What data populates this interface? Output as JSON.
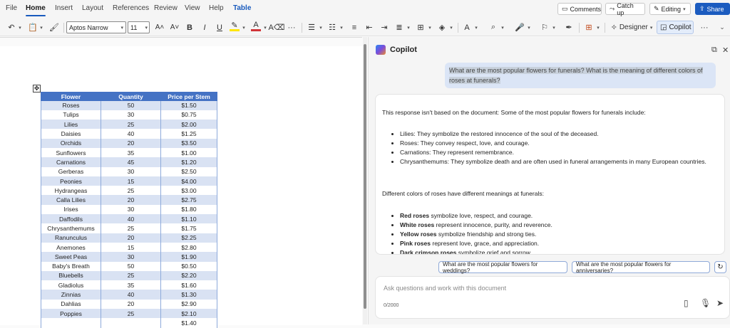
{
  "ribbon_tabs": [
    "File",
    "Home",
    "Insert",
    "Layout",
    "References",
    "Review",
    "View",
    "Help",
    "Table"
  ],
  "top_buttons": {
    "comments": "Comments",
    "catch_up": "Catch up",
    "editing": "Editing",
    "share": "Share"
  },
  "toolbar": {
    "font_name": "Aptos Narrow",
    "font_size": "11",
    "designer": "Designer",
    "copilot": "Copilot"
  },
  "table": {
    "headers": [
      "Flower",
      "Quantity",
      "Price per Stem"
    ],
    "rows": [
      [
        "Roses",
        "50",
        "$1.50"
      ],
      [
        "Tulips",
        "30",
        "$0.75"
      ],
      [
        "Lilies",
        "25",
        "$2.00"
      ],
      [
        "Daisies",
        "40",
        "$1.25"
      ],
      [
        "Orchids",
        "20",
        "$3.50"
      ],
      [
        "Sunflowers",
        "35",
        "$1.00"
      ],
      [
        "Carnations",
        "45",
        "$1.20"
      ],
      [
        "Gerberas",
        "30",
        "$2.50"
      ],
      [
        "Peonies",
        "15",
        "$4.00"
      ],
      [
        "Hydrangeas",
        "25",
        "$3.00"
      ],
      [
        "Calla Lilies",
        "20",
        "$2.75"
      ],
      [
        "Irises",
        "30",
        "$1.80"
      ],
      [
        "Daffodils",
        "40",
        "$1.10"
      ],
      [
        "Chrysanthemums",
        "25",
        "$1.75"
      ],
      [
        "Ranunculus",
        "20",
        "$2.25"
      ],
      [
        "Anemones",
        "15",
        "$2.80"
      ],
      [
        "Sweet Peas",
        "30",
        "$1.90"
      ],
      [
        "Baby's Breath",
        "50",
        "$0.50"
      ],
      [
        "Bluebells",
        "25",
        "$2.20"
      ],
      [
        "Gladiolus",
        "35",
        "$1.60"
      ],
      [
        "Zinnias",
        "40",
        "$1.30"
      ],
      [
        "Dahlias",
        "20",
        "$2.90"
      ],
      [
        "Poppies",
        "25",
        "$2.10"
      ],
      [
        "",
        "",
        "$1.40"
      ]
    ]
  },
  "copilot": {
    "title": "Copilot",
    "user_prompt": "What are the most popular flowers for funerals? What is the meaning of different colors of roses at funerals?",
    "response_intro": "This response isn't based on the document: Some of the most popular flowers for funerals include:",
    "flower_items": [
      "Lilies: They symbolize the restored innocence of the soul of the deceased.",
      "Roses: They convey respect, love, and courage.",
      "Carnations: They represent remembrance.",
      "Chrysanthemums: They symbolize death and are often used in funeral arrangements in many European countries."
    ],
    "colors_intro": "Different colors of roses have different meanings at funerals:",
    "rose_items": [
      {
        "bold": "Red roses",
        "text": " symbolize love, respect, and courage."
      },
      {
        "bold": "White roses",
        "text": " represent innocence, purity, and reverence."
      },
      {
        "bold": "Yellow roses",
        "text": " symbolize friendship and strong ties."
      },
      {
        "bold": "Pink roses",
        "text": " represent love, grace, and appreciation."
      },
      {
        "bold": "Dark crimson roses",
        "text": " symbolize grief and sorrow."
      }
    ],
    "suggestions": [
      "What are the most popular flowers for weddings?",
      "What are the most popular flowers for anniversaries?"
    ],
    "input_placeholder": "Ask questions and work with this document",
    "char_count": "0/2000"
  }
}
